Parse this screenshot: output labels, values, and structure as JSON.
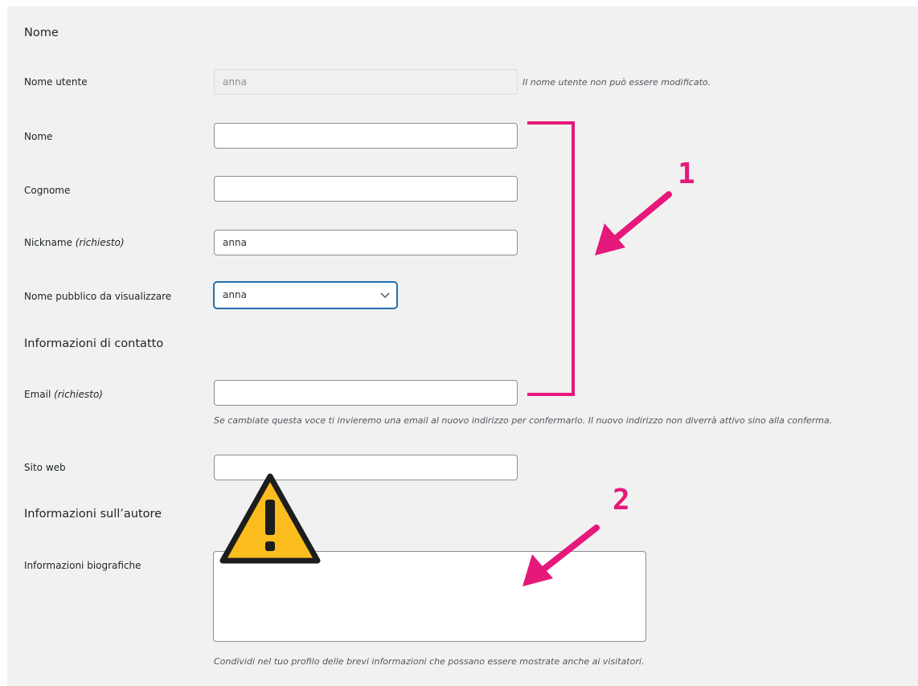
{
  "sections": {
    "name": "Nome",
    "contact": "Informazioni di contatto",
    "about": "Informazioni sull’autore"
  },
  "fields": {
    "username": {
      "label": "Nome utente",
      "value": "anna",
      "note": "Il nome utente non può essere modificato."
    },
    "first_name": {
      "label": "Nome",
      "value": ""
    },
    "last_name": {
      "label": "Cognome",
      "value": ""
    },
    "nickname": {
      "label": "Nickname",
      "required": "(richiesto)",
      "value": "anna"
    },
    "display_name": {
      "label": "Nome pubblico da visualizzare",
      "value": "anna"
    },
    "email": {
      "label": "Email",
      "required": "(richiesto)",
      "value": "",
      "note": "Se cambiate questa voce ti invieremo una email al nuovo indirizzo per confermarlo. Il nuovo indirizzo non diverrà attivo sino alla conferma."
    },
    "website": {
      "label": "Sito web",
      "value": ""
    },
    "bio": {
      "label": "Informazioni biografiche",
      "value": "",
      "note": "Condividi nel tuo profilo delle brevi informazioni che possano essere mostrate anche ai visitatori."
    }
  },
  "annotations": {
    "one": "1",
    "two": "2",
    "color": "#e6187a",
    "warning_color": "#fbbd1d"
  }
}
